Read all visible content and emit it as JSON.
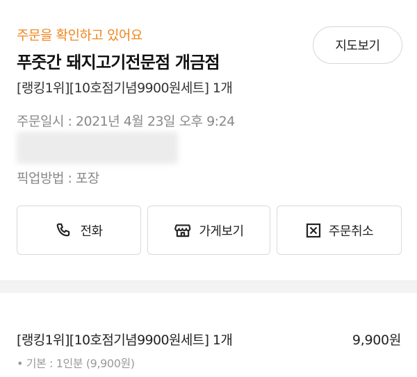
{
  "order": {
    "status": "주문을 확인하고 있어요",
    "store_name": "푸줏간 돼지고기전문점 개금점",
    "summary": "[랭킹1위][10호점기념9900원세트] 1개",
    "date": "주문일시 : 2021년 4월 23일 오후 9:24",
    "pickup": "픽업방법 : 포장"
  },
  "header": {
    "map_label": "지도보기"
  },
  "actions": {
    "call_label": "전화",
    "call_icon": "phone-icon",
    "store_label": "가게보기",
    "store_icon": "storefront-icon",
    "cancel_label": "주문취소",
    "cancel_icon": "x-box-icon"
  },
  "items": [
    {
      "name": "[랭킹1위][10호점기념9900원세트] 1개",
      "price": "9,900원",
      "option": "• 기본 : 1인분 (9,900원)"
    }
  ],
  "colors": {
    "accent": "#f0851a"
  }
}
